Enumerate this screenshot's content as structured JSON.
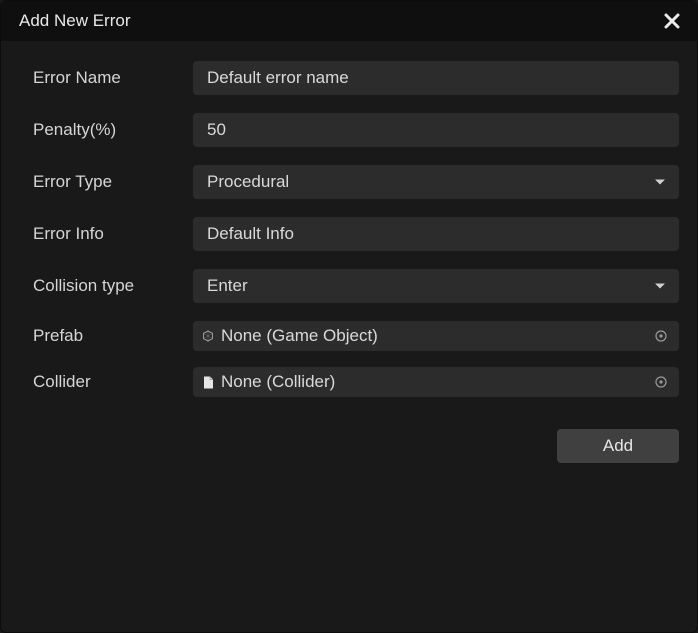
{
  "window": {
    "title": "Add New Error"
  },
  "fields": {
    "error_name": {
      "label": "Error Name",
      "value": "Default error name"
    },
    "penalty": {
      "label": "Penalty(%)",
      "value": "50"
    },
    "error_type": {
      "label": "Error Type",
      "value": "Procedural"
    },
    "error_info": {
      "label": "Error Info",
      "value": "Default Info"
    },
    "collision": {
      "label": "Collision type",
      "value": "Enter"
    },
    "prefab": {
      "label": "Prefab",
      "value": "None (Game Object)"
    },
    "collider": {
      "label": "Collider",
      "value": "None (Collider)"
    }
  },
  "buttons": {
    "add": "Add"
  }
}
